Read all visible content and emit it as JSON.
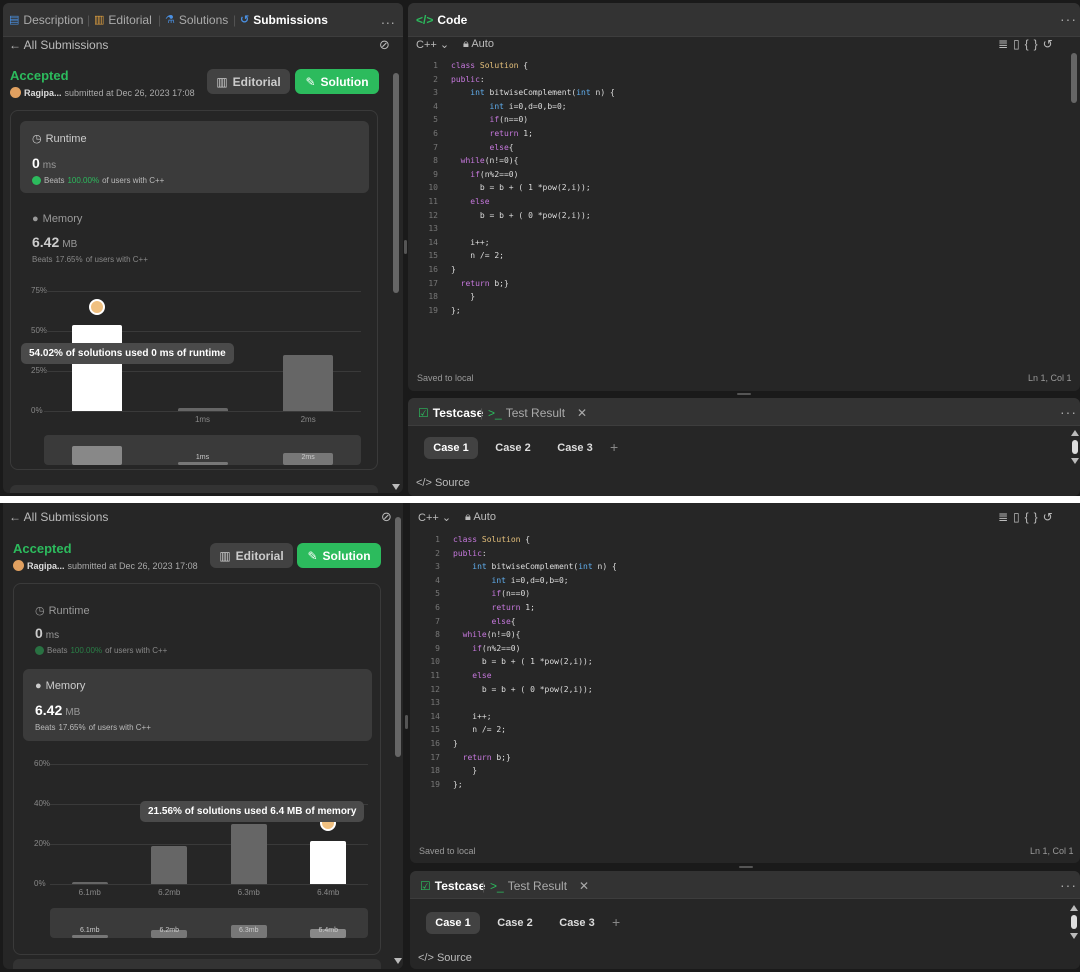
{
  "top": {
    "left": {
      "tabs": [
        {
          "label": "Description"
        },
        {
          "label": "Editorial"
        },
        {
          "label": "Solutions"
        },
        {
          "label": "Submissions"
        }
      ],
      "more": "...",
      "back": "All Submissions",
      "status": "Accepted",
      "user": "Ragipa...",
      "submitted": "submitted at Dec 26, 2023 17:08",
      "editorial_btn": "Editorial",
      "solution_btn": "Solution",
      "runtime": {
        "title": "Runtime",
        "value": "0",
        "unit": "ms",
        "beats_prefix": "Beats",
        "beats_pct": "100.00%",
        "beats_suffix": "of users with C++"
      },
      "memory": {
        "title": "Memory",
        "value": "6.42",
        "unit": "MB",
        "beats_prefix": "Beats",
        "beats_pct": "17.65%",
        "beats_suffix": "of users with C++"
      },
      "chart": {
        "yticks": [
          "75%",
          "50%",
          "25%",
          "0%"
        ],
        "bars": [
          {
            "label": "",
            "value": 54.02
          },
          {
            "label": "1ms",
            "value": 2
          },
          {
            "label": "2ms",
            "value": 35
          }
        ],
        "tooltip": "54.02% of solutions used 0 ms of runtime",
        "mini_labels": [
          "",
          "1ms",
          "2ms"
        ]
      }
    },
    "code": {
      "title": "Code",
      "lang": "C++",
      "mode": "Auto",
      "saved": "Saved to local",
      "pos": "Ln 1, Col 1"
    },
    "testcase": {
      "tab": "Testcase",
      "result_tab": "Test Result",
      "close": "✕",
      "cases": [
        "Case 1",
        "Case 2",
        "Case 3"
      ],
      "plus": "+",
      "source": "Source"
    }
  },
  "bottom": {
    "left": {
      "back": "All Submissions",
      "status": "Accepted",
      "user": "Ragipa...",
      "submitted": "submitted at Dec 26, 2023 17:08",
      "editorial_btn": "Editorial",
      "solution_btn": "Solution",
      "runtime": {
        "title": "Runtime",
        "value": "0",
        "unit": "ms",
        "beats_prefix": "Beats",
        "beats_pct": "100.00%",
        "beats_suffix": "of users with C++"
      },
      "memory": {
        "title": "Memory",
        "value": "6.42",
        "unit": "MB",
        "beats_prefix": "Beats",
        "beats_pct": "17.65%",
        "beats_suffix": "of users with C++"
      },
      "chart": {
        "yticks": [
          "60%",
          "40%",
          "20%",
          "0%"
        ],
        "bars": [
          {
            "label": "6.1mb",
            "value": 1
          },
          {
            "label": "6.2mb",
            "value": 19
          },
          {
            "label": "6.3mb",
            "value": 30
          },
          {
            "label": "6.4mb",
            "value": 21.56
          }
        ],
        "tooltip": "21.56% of solutions used 6.4 MB of memory",
        "mini_labels": [
          "6.1mb",
          "6.2mb",
          "6.3mb",
          "6.4mb"
        ]
      }
    },
    "code": {
      "lang": "C++",
      "mode": "Auto",
      "saved": "Saved to local",
      "pos": "Ln 1, Col 1"
    },
    "testcase": {
      "tab": "Testcase",
      "result_tab": "Test Result",
      "close": "✕",
      "cases": [
        "Case 1",
        "Case 2",
        "Case 3"
      ],
      "plus": "+",
      "source": "Source"
    }
  },
  "code_lines": [
    "class Solution {",
    "public:",
    "    int bitwiseComplement(int n) {",
    "        int i=0,d=0,b=0;",
    "        if(n==0)",
    "        return 1;",
    "        else{",
    "  while(n!=0){",
    "    if(n%2==0)",
    "      b = b + ( 1 *pow(2,i));",
    "    else",
    "      b = b + ( 0 *pow(2,i));",
    "",
    "    i++;",
    "    n /= 2;",
    "}",
    "  return b;}",
    "    }",
    "};"
  ]
}
